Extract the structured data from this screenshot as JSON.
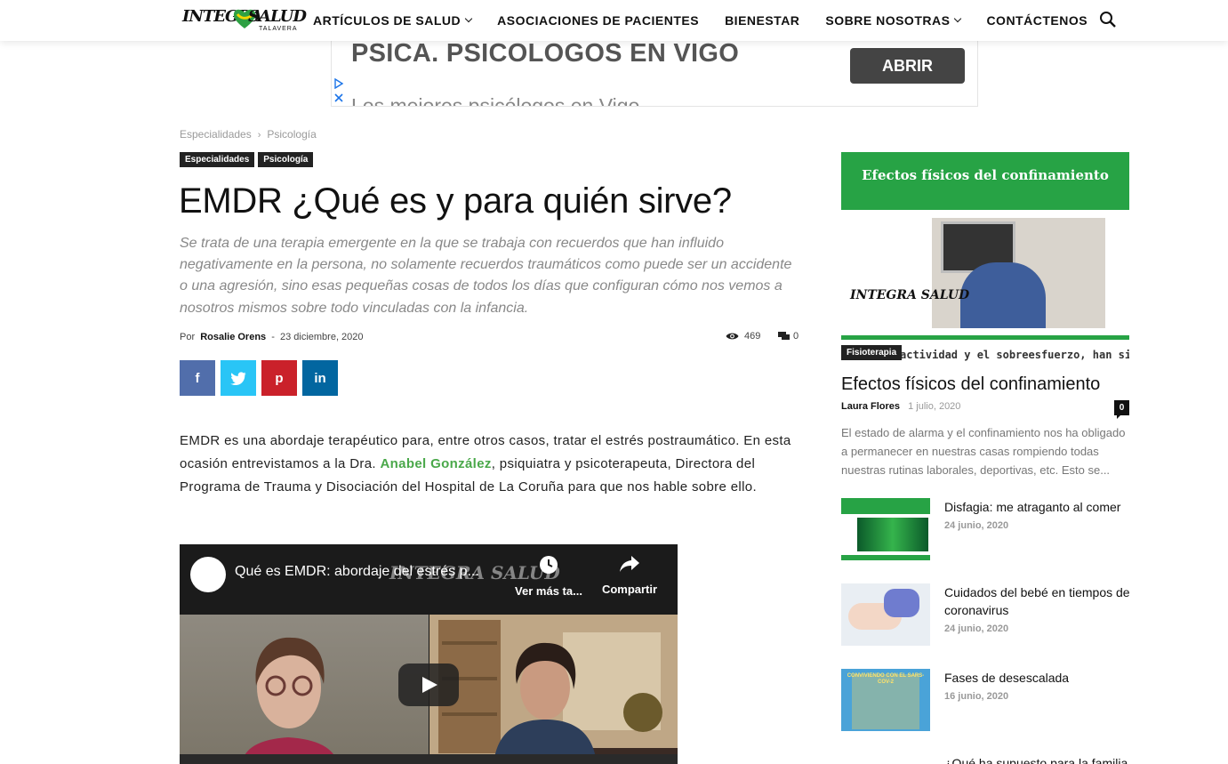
{
  "header": {
    "logo": {
      "word1": "INTEGRA",
      "word2": "SALUD",
      "city": "TALAVERA"
    },
    "nav": [
      {
        "label": "ARTÍCULOS DE SALUD",
        "dropdown": true
      },
      {
        "label": "ASOCIACIONES DE PACIENTES",
        "dropdown": false
      },
      {
        "label": "BIENESTAR",
        "dropdown": false
      },
      {
        "label": "SOBRE NOSOTRAS",
        "dropdown": true
      },
      {
        "label": "CONTÁCTENOS",
        "dropdown": false
      }
    ],
    "search_icon": "search-icon"
  },
  "ad": {
    "headline": "PSICA. PSICOLOGOS EN VIGO",
    "subline": "Los mejores psicólogos en Vigo",
    "button": "ABRIR"
  },
  "article": {
    "breadcrumb": [
      "Especialidades",
      "Psicología"
    ],
    "tags": [
      "Especialidades",
      "Psicología"
    ],
    "title": "EMDR ¿Qué es y para quién sirve?",
    "lead": "Se trata de una terapia emergente en la que se trabaja con recuerdos que han influido negativamente en la persona, no solamente recuerdos traumáticos como puede ser un accidente o una agresión, sino esas pequeñas cosas de todos los días que configuran cómo nos vemos a nosotros mismos sobre todo vinculadas con la infancia.",
    "byline_prefix": "Por",
    "author": "Rosalie Orens",
    "date_sep": "-",
    "date": "23 diciembre, 2020",
    "views": "469",
    "comments": "0",
    "share": [
      "f",
      "t",
      "p",
      "in"
    ],
    "body": {
      "before_link": "EMDR es una abordaje terapéutico para, entre otros casos, tratar el estrés postraumático. En esta ocasión entrevistamos a la Dra. ",
      "link": "Anabel González",
      "after_link": ", psiquiatra y psicoterapeuta, Directora del Programa de Trauma y Disociación del Hospital de La Coruña para que nos hable sobre ello."
    },
    "video": {
      "title": "Qué es EMDR: abordaje del estrés p...",
      "watch_later": "Ver más ta...",
      "share": "Compartir",
      "watermark": "INTEGRA SALUD"
    }
  },
  "sidebar": {
    "featured": {
      "banner_title": "Efectos físicos del confinamiento",
      "image_logo": "INTEGRA SALUD",
      "image_strip": "actividad y el sobreesfuerzo, han sido los",
      "category": "Fisioterapia",
      "title": "Efectos físicos del confinamiento",
      "author": "Laura Flores",
      "date": "1 julio, 2020",
      "comments": "0",
      "excerpt": "El estado de alarma y el confinamiento nos ha obligado a permanecer en nuestras casas rompiendo todas nuestras rutinas laborales, deportivas, etc. Esto se..."
    },
    "posts": [
      {
        "title": "Disfagia: me atraganto al comer",
        "date": "24 junio, 2020"
      },
      {
        "title": "Cuidados del bebé en tiempos de coronavirus",
        "date": "24 junio, 2020"
      },
      {
        "title": "Fases de desescalada",
        "date": "16 junio, 2020",
        "thumb_text": "CONVIVIENDO CON EL SARS-COV-2"
      },
      {
        "title": "¿Qué ha supuesto para la familia"
      }
    ]
  }
}
